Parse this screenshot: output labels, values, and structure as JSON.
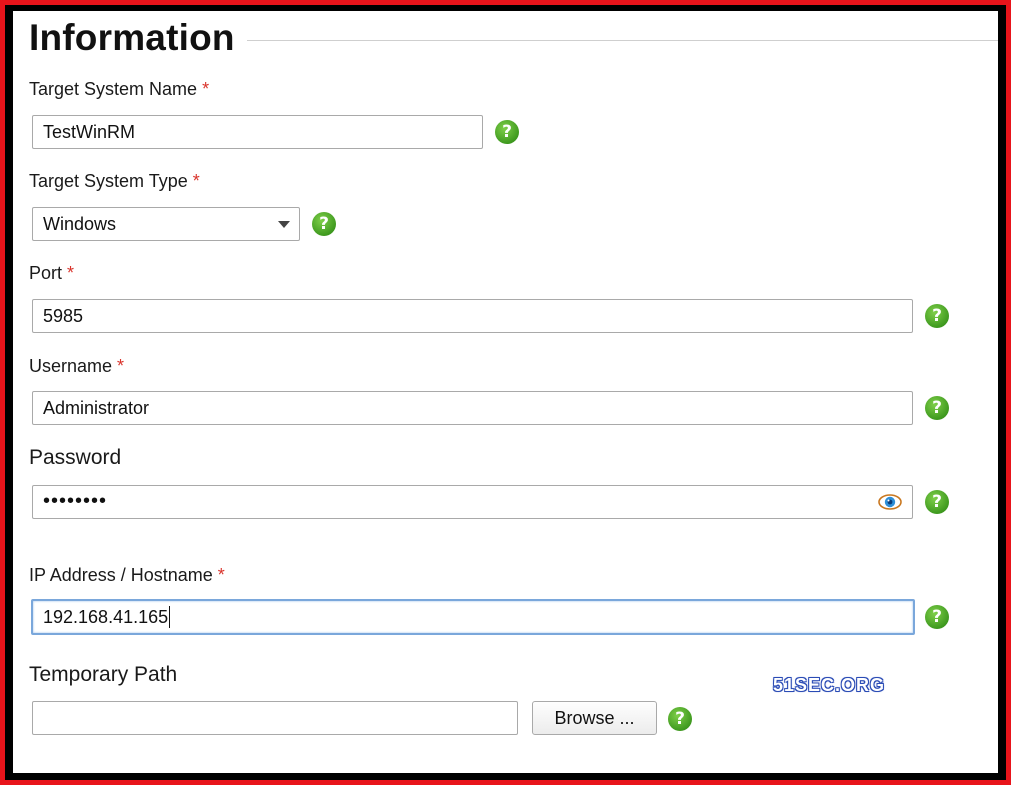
{
  "section": {
    "title": "Information"
  },
  "required_marker": "*",
  "fields": {
    "target_name": {
      "label": "Target System Name",
      "value": "TestWinRM"
    },
    "target_type": {
      "label": "Target System Type",
      "value": "Windows"
    },
    "port": {
      "label": "Port",
      "value": "5985"
    },
    "username": {
      "label": "Username",
      "value": "Administrator"
    },
    "password": {
      "label": "Password",
      "value": "••••••••"
    },
    "ip": {
      "label": "IP Address / Hostname",
      "value": "192.168.41.165"
    },
    "temp_path": {
      "label": "Temporary Path",
      "value": "",
      "browse_label": "Browse ..."
    }
  },
  "help_glyph": "?",
  "watermark": "51SEC.ORG",
  "colors": {
    "frame_red": "#e8141b",
    "required": "#d9332b",
    "help_green": "#3f9a1f",
    "focus_blue": "#7aa7db"
  },
  "icons": {
    "help": "help-icon",
    "eye": "eye-icon",
    "dropdown": "chevron-down-icon"
  }
}
